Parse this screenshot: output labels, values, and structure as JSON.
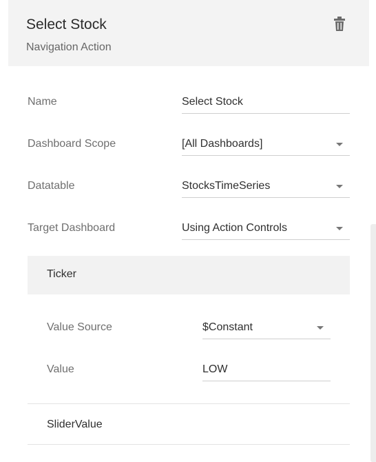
{
  "header": {
    "title": "Select Stock",
    "subtitle": "Navigation Action",
    "delete_icon": "trash-icon"
  },
  "form": {
    "name": {
      "label": "Name",
      "value": "Select Stock"
    },
    "dashboard_scope": {
      "label": "Dashboard Scope",
      "value": "[All Dashboards]"
    },
    "datatable": {
      "label": "Datatable",
      "value": "StocksTimeSeries"
    },
    "target_dashboard": {
      "label": "Target Dashboard",
      "value": "Using Action Controls"
    }
  },
  "parameters": {
    "ticker": {
      "title": "Ticker",
      "value_source": {
        "label": "Value Source",
        "value": "$Constant"
      },
      "value": {
        "label": "Value",
        "value": "LOW"
      }
    },
    "slider_value": {
      "title": "SliderValue"
    }
  },
  "colors": {
    "header_bg": "#f3f3f3",
    "section_bg": "#f2f2f2",
    "label_text": "#6f6f6f",
    "value_text": "#2f2f2f"
  }
}
